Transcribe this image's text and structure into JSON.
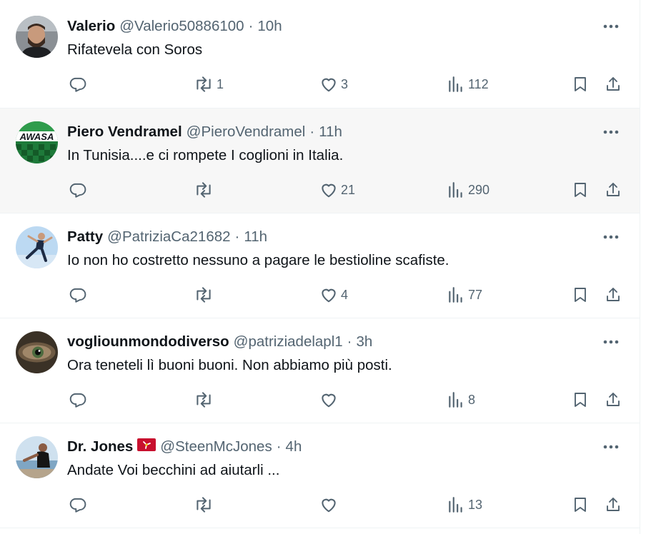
{
  "replies": [
    {
      "name": "Valerio",
      "handle": "@Valerio50886100",
      "separator": "·",
      "time": "10h",
      "text": "Rifatevela con Soros",
      "retweets": "1",
      "likes": "3",
      "views": "112",
      "avatar_icon": "avatar-valerio"
    },
    {
      "name": "Piero Vendramel",
      "handle": "@PieroVendramel",
      "separator": "·",
      "time": "11h",
      "text": "In Tunisia....e ci rompete I coglioni in Italia.",
      "retweets": "",
      "likes": "21",
      "views": "290",
      "avatar_text": "AWASA",
      "avatar_icon": "avatar-kawasaki"
    },
    {
      "name": "Patty",
      "handle": "@PatriziaCa21682",
      "separator": "·",
      "time": "11h",
      "text": "Io non ho costretto nessuno a pagare le bestioline scafiste.",
      "retweets": "",
      "likes": "4",
      "views": "77",
      "avatar_icon": "avatar-jumper"
    },
    {
      "name": "vogliounmondodiverso",
      "handle": "@patriziadelapl1",
      "separator": "·",
      "time": "3h",
      "text": "Ora teneteli lì buoni buoni. Non abbiamo più posti.",
      "retweets": "",
      "likes": "",
      "views": "8",
      "avatar_icon": "avatar-eye"
    },
    {
      "name": "Dr. Jones",
      "handle": "@SteenMcJones",
      "separator": "·",
      "time": "4h",
      "text": "Andate Voi becchini ad aiutarli ...",
      "retweets": "",
      "likes": "",
      "views": "13",
      "flag_icon": "isle-of-man-flag-icon",
      "avatar_icon": "avatar-man-sea"
    }
  ],
  "colors": {
    "text_primary": "#0f1419",
    "text_secondary": "#536471",
    "divider": "#eff3f4",
    "hover_background": "#f7f7f7",
    "flag_red": "#c8102e"
  }
}
